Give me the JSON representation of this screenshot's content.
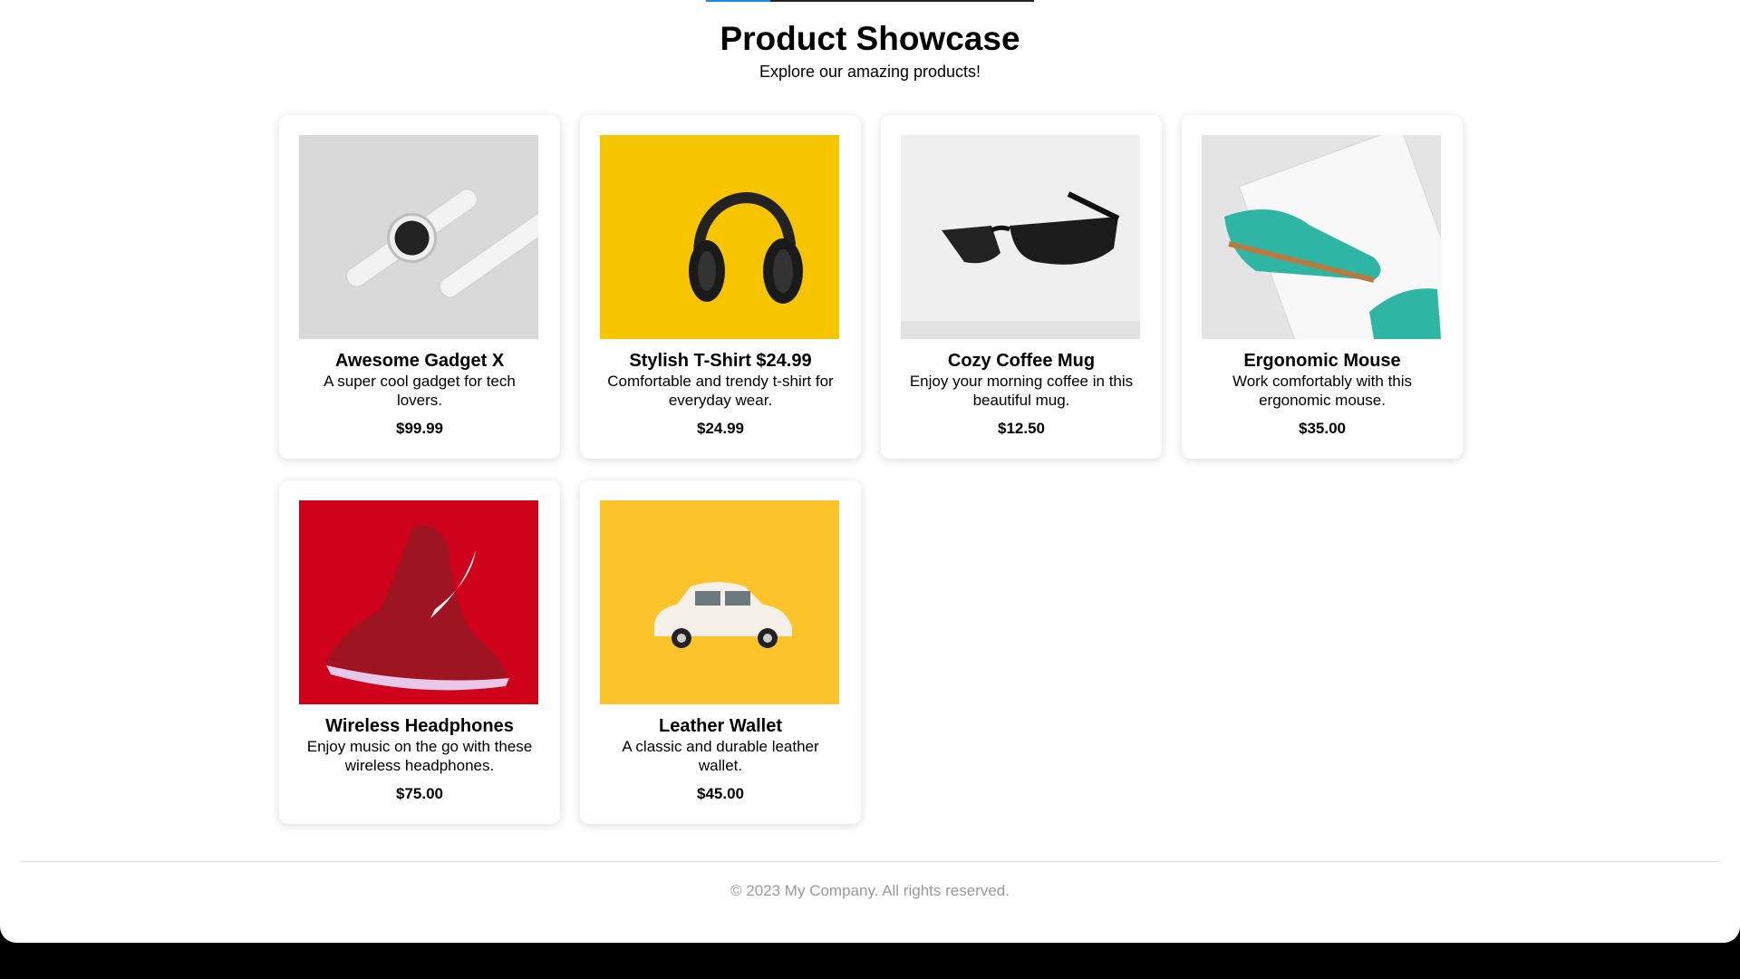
{
  "header": {
    "title": "Product Showcase",
    "subtitle": "Explore our amazing products!"
  },
  "products": [
    {
      "name": "Awesome Gadget X",
      "description": "A super cool gadget for tech lovers.",
      "price": "$99.99",
      "image_icon": "watch-icon",
      "bg": "#d9d9d9"
    },
    {
      "name": "Stylish T-Shirt $24.99",
      "description": "Comfortable and trendy t-shirt for everyday wear.",
      "price": "$24.99",
      "image_icon": "headphones-icon",
      "bg": "#f7c500"
    },
    {
      "name": "Cozy Coffee Mug",
      "description": "Enjoy your morning coffee in this beautiful mug.",
      "price": "$12.50",
      "image_icon": "sunglasses-icon",
      "bg": "#efefef"
    },
    {
      "name": "Ergonomic Mouse",
      "description": "Work comfortably with this ergonomic mouse.",
      "price": "$35.00",
      "image_icon": "shoes-icon",
      "bg": "#e4e4e4"
    },
    {
      "name": "Wireless Headphones",
      "description": "Enjoy music on the go with these wireless headphones.",
      "price": "$75.00",
      "image_icon": "sneaker-icon",
      "bg": "#d0021b"
    },
    {
      "name": "Leather Wallet",
      "description": "A classic and durable leather wallet.",
      "price": "$45.00",
      "image_icon": "toy-car-icon",
      "bg": "#fcc42a"
    }
  ],
  "footer": {
    "copyright": "© 2023 My Company. All rights reserved."
  }
}
